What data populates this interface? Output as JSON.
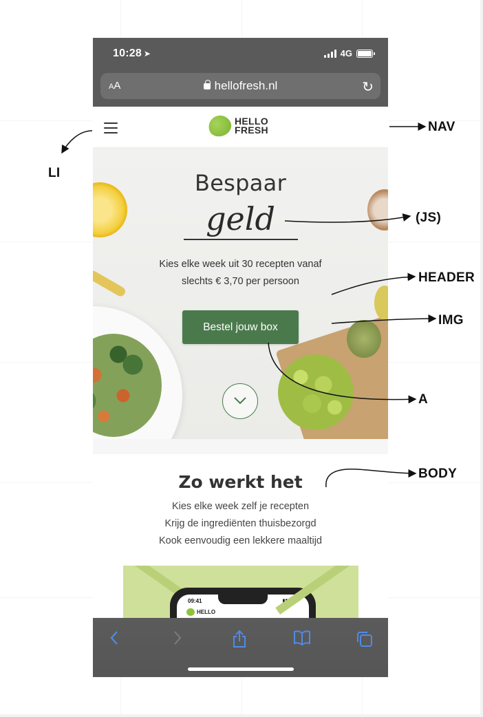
{
  "status_bar": {
    "time": "10:28",
    "location_glyph": "➤",
    "network": "4G"
  },
  "browser": {
    "text_size_label": "AA",
    "url": "hellofresh.nl"
  },
  "nav": {
    "logo_line1": "HELLO",
    "logo_line2": "FRESH"
  },
  "hero": {
    "title": "Bespaar",
    "rotating_word": "geld",
    "subtitle_line1": "Kies elke week uit 30 recepten vanaf",
    "subtitle_line2": "slechts € 3,70 per persoon",
    "cta_label": "Bestel jouw box"
  },
  "how_it_works": {
    "title": "Zo werkt het",
    "lines": [
      "Kies elke week zelf je recepten",
      "Krijg de ingrediënten thuisbezorgd",
      "Kook eenvoudig een lekkere maaltijd"
    ]
  },
  "promo_phone": {
    "time": "09:41",
    "logo": "HELLO"
  },
  "annotations": {
    "nav": "NAV",
    "li": "LI",
    "js": "(JS)",
    "header": "HEADER",
    "img": "IMG",
    "a": "A",
    "body": "BODY"
  },
  "colors": {
    "brand_green": "#4a7a4c",
    "logo_lime": "#8cc33a",
    "safari_blue": "#4f8be6"
  },
  "icons": [
    "hamburger-icon",
    "lock-icon",
    "reload-icon",
    "chevron-down-icon",
    "back-icon",
    "forward-icon",
    "share-icon",
    "bookmarks-icon",
    "tabs-icon"
  ]
}
